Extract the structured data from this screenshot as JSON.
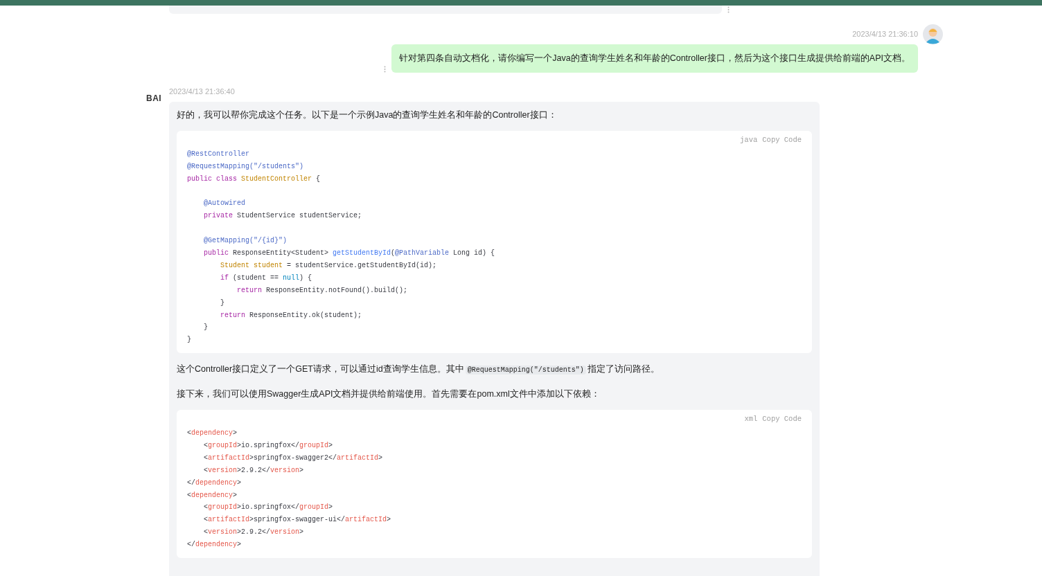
{
  "user_message": {
    "time": "2023/4/13 21:36:10",
    "text": "针对第四条自动文档化，请你编写一个Java的查询学生姓名和年龄的Controller接口，然后为这个接口生成提供给前端的API文档。"
  },
  "assistant_message": {
    "logo": "BAI",
    "time": "2023/4/13 21:36:40",
    "blocks": [
      {
        "kind": "paragraph",
        "text": "好的，我可以帮你完成这个任务。以下是一个示例Java的查询学生姓名和年龄的Controller接口："
      },
      {
        "kind": "code",
        "language": "java",
        "copy_label": "Copy Code",
        "tokens": [
          {
            "kind": "annotation",
            "text": "@RestController\n@RequestMapping(\"/students\")\n"
          },
          {
            "kind": "keyword",
            "text": "public"
          },
          {
            "kind": "keyword",
            "text": " class"
          },
          {
            "kind": "type",
            "text": " StudentController"
          },
          {
            "kind": "plain",
            "text": " {\n\n    "
          },
          {
            "kind": "annotation",
            "text": "@Autowired\n    "
          },
          {
            "kind": "keyword",
            "text": "private"
          },
          {
            "kind": "plain",
            "text": " StudentService studentService;\n\n    "
          },
          {
            "kind": "annotation",
            "text": "@GetMapping(\"/{id}\")\n    "
          },
          {
            "kind": "keyword",
            "text": "public"
          },
          {
            "kind": "plain",
            "text": " ResponseEntity<Student> "
          },
          {
            "kind": "function",
            "text": "getStudentById"
          },
          {
            "kind": "plain",
            "text": "("
          },
          {
            "kind": "annotation",
            "text": "@PathVariable"
          },
          {
            "kind": "plain",
            "text": " Long id) {\n        "
          },
          {
            "kind": "type",
            "text": "Student student"
          },
          {
            "kind": "plain",
            "text": " = studentService.getStudentById(id);\n        "
          },
          {
            "kind": "keyword",
            "text": "if"
          },
          {
            "kind": "plain",
            "text": " (student == "
          },
          {
            "kind": "literal",
            "text": "null"
          },
          {
            "kind": "plain",
            "text": ") {\n            "
          },
          {
            "kind": "keyword",
            "text": "return"
          },
          {
            "kind": "plain",
            "text": " ResponseEntity.notFound().build();\n        }\n        "
          },
          {
            "kind": "keyword",
            "text": "return"
          },
          {
            "kind": "plain",
            "text": " ResponseEntity.ok(student);\n    }\n}"
          }
        ]
      },
      {
        "kind": "paragraph",
        "text": "这个Controller接口定义了一个GET请求，可以通过id查询学生信息。其中",
        "code": "@RequestMapping(\"/students\")",
        "text_after": "指定了访问路径。"
      },
      {
        "kind": "paragraph",
        "text": "接下来，我们可以使用Swagger生成API文档并提供给前端使用。首先需要在pom.xml文件中添加以下依赖："
      },
      {
        "kind": "code",
        "language": "xml",
        "copy_label": "Copy Code",
        "tokens": [
          {
            "kind": "plain",
            "text": "<"
          },
          {
            "kind": "tag",
            "text": "dependency"
          },
          {
            "kind": "plain",
            "text": ">\n    <"
          },
          {
            "kind": "tag",
            "text": "groupId"
          },
          {
            "kind": "plain",
            "text": ">io.springfox</"
          },
          {
            "kind": "tag",
            "text": "groupId"
          },
          {
            "kind": "plain",
            "text": ">\n    <"
          },
          {
            "kind": "tag",
            "text": "artifactId"
          },
          {
            "kind": "plain",
            "text": ">springfox-swagger2</"
          },
          {
            "kind": "tag",
            "text": "artifactId"
          },
          {
            "kind": "plain",
            "text": ">\n    <"
          },
          {
            "kind": "tag",
            "text": "version"
          },
          {
            "kind": "plain",
            "text": ">2.9.2</"
          },
          {
            "kind": "tag",
            "text": "version"
          },
          {
            "kind": "plain",
            "text": ">\n</"
          },
          {
            "kind": "tag",
            "text": "dependency"
          },
          {
            "kind": "plain",
            "text": ">\n<"
          },
          {
            "kind": "tag",
            "text": "dependency"
          },
          {
            "kind": "plain",
            "text": ">\n    <"
          },
          {
            "kind": "tag",
            "text": "groupId"
          },
          {
            "kind": "plain",
            "text": ">io.springfox</"
          },
          {
            "kind": "tag",
            "text": "groupId"
          },
          {
            "kind": "plain",
            "text": ">\n    <"
          },
          {
            "kind": "tag",
            "text": "artifactId"
          },
          {
            "kind": "plain",
            "text": ">springfox-swagger-ui</"
          },
          {
            "kind": "tag",
            "text": "artifactId"
          },
          {
            "kind": "plain",
            "text": ">\n    <"
          },
          {
            "kind": "tag",
            "text": "version"
          },
          {
            "kind": "plain",
            "text": ">2.9.2</"
          },
          {
            "kind": "tag",
            "text": "version"
          },
          {
            "kind": "plain",
            "text": ">\n</"
          },
          {
            "kind": "tag",
            "text": "dependency"
          },
          {
            "kind": "plain",
            "text": ">"
          }
        ]
      }
    ]
  }
}
